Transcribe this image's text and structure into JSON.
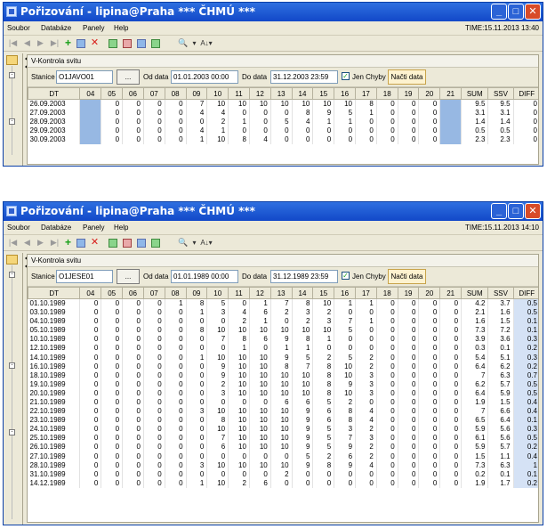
{
  "screens": [
    {
      "title": "Pořizování - lipina@Praha *** ČHMÚ ***",
      "menu": [
        "Soubor",
        "Databáze",
        "Panely",
        "Help"
      ],
      "time": "TIME:15.11.2013 13:40",
      "panel_title": "V-Kontrola svitu",
      "station_label": "Stanice",
      "station_value": "O1JAVO01",
      "browse_label": "...",
      "from_label": "Od data",
      "from_value": "01.01.2003 00:00",
      "to_label": "Do data",
      "to_value": "31.12.2003 23:59",
      "errors_label": "Jen Chyby",
      "load_label": "Načti data",
      "columns": [
        "DT",
        "04",
        "05",
        "06",
        "07",
        "08",
        "09",
        "10",
        "11",
        "12",
        "13",
        "14",
        "15",
        "16",
        "17",
        "18",
        "19",
        "20",
        "21",
        "SUM",
        "SSV",
        "DIFF"
      ],
      "rows": [
        [
          "26.09.2003",
          "",
          "0",
          "0",
          "0",
          "0",
          "7",
          "10",
          "10",
          "10",
          "10",
          "10",
          "10",
          "10",
          "8",
          "0",
          "0",
          "0",
          "",
          "9.5",
          "9.5",
          "0"
        ],
        [
          "27.09.2003",
          "",
          "0",
          "0",
          "0",
          "0",
          "4",
          "4",
          "0",
          "0",
          "0",
          "8",
          "9",
          "5",
          "1",
          "0",
          "0",
          "0",
          "",
          "3.1",
          "3.1",
          "0"
        ],
        [
          "28.09.2003",
          "",
          "0",
          "0",
          "0",
          "0",
          "0",
          "2",
          "1",
          "0",
          "5",
          "4",
          "1",
          "1",
          "0",
          "0",
          "0",
          "0",
          "",
          "1.4",
          "1.4",
          "0"
        ],
        [
          "29.09.2003",
          "",
          "0",
          "0",
          "0",
          "0",
          "4",
          "1",
          "0",
          "0",
          "0",
          "0",
          "0",
          "0",
          "0",
          "0",
          "0",
          "0",
          "",
          "0.5",
          "0.5",
          "0"
        ],
        [
          "30.09.2003",
          "",
          "0",
          "0",
          "0",
          "0",
          "1",
          "10",
          "8",
          "4",
          "0",
          "0",
          "0",
          "0",
          "0",
          "0",
          "0",
          "0",
          "",
          "2.3",
          "2.3",
          "0"
        ]
      ]
    },
    {
      "title": "Pořizování - lipina@Praha *** ČHMÚ ***",
      "menu": [
        "Soubor",
        "Databáze",
        "Panely",
        "Help"
      ],
      "time": "TIME:15.11.2013 14:10",
      "panel_title": "V-Kontrola svitu",
      "station_label": "Stanice",
      "station_value": "O1JESE01",
      "browse_label": "...",
      "from_label": "Od data",
      "from_value": "01.01.1989 00:00",
      "to_label": "Do data",
      "to_value": "31.12.1989 23:59",
      "errors_label": "Jen Chyby",
      "load_label": "Načti data",
      "columns": [
        "DT",
        "04",
        "05",
        "06",
        "07",
        "08",
        "09",
        "10",
        "11",
        "12",
        "13",
        "14",
        "15",
        "16",
        "17",
        "18",
        "19",
        "20",
        "21",
        "SUM",
        "SSV",
        "DIFF"
      ],
      "rows": [
        [
          "01.10.1989",
          "0",
          "0",
          "0",
          "0",
          "1",
          "8",
          "5",
          "0",
          "1",
          "7",
          "8",
          "10",
          "1",
          "1",
          "0",
          "0",
          "0",
          "0",
          "4.2",
          "3.7",
          "0.5"
        ],
        [
          "03.10.1989",
          "0",
          "0",
          "0",
          "0",
          "0",
          "1",
          "3",
          "4",
          "6",
          "2",
          "3",
          "2",
          "0",
          "0",
          "0",
          "0",
          "0",
          "0",
          "2.1",
          "1.6",
          "0.5"
        ],
        [
          "04.10.1989",
          "0",
          "0",
          "0",
          "0",
          "0",
          "0",
          "0",
          "2",
          "1",
          "0",
          "2",
          "3",
          "7",
          "1",
          "0",
          "0",
          "0",
          "0",
          "1.6",
          "1.5",
          "0.1"
        ],
        [
          "05.10.1989",
          "0",
          "0",
          "0",
          "0",
          "0",
          "8",
          "10",
          "10",
          "10",
          "10",
          "10",
          "10",
          "5",
          "0",
          "0",
          "0",
          "0",
          "0",
          "7.3",
          "7.2",
          "0.1"
        ],
        [
          "10.10.1989",
          "0",
          "0",
          "0",
          "0",
          "0",
          "0",
          "7",
          "8",
          "6",
          "9",
          "8",
          "1",
          "0",
          "0",
          "0",
          "0",
          "0",
          "0",
          "3.9",
          "3.6",
          "0.3"
        ],
        [
          "12.10.1989",
          "0",
          "0",
          "0",
          "0",
          "0",
          "0",
          "0",
          "1",
          "0",
          "1",
          "1",
          "0",
          "0",
          "0",
          "0",
          "0",
          "0",
          "0",
          "0.3",
          "0.1",
          "0.2"
        ],
        [
          "14.10.1989",
          "0",
          "0",
          "0",
          "0",
          "0",
          "1",
          "10",
          "10",
          "10",
          "9",
          "5",
          "2",
          "5",
          "2",
          "0",
          "0",
          "0",
          "0",
          "5.4",
          "5.1",
          "0.3"
        ],
        [
          "16.10.1989",
          "0",
          "0",
          "0",
          "0",
          "0",
          "0",
          "9",
          "10",
          "10",
          "8",
          "7",
          "8",
          "10",
          "2",
          "0",
          "0",
          "0",
          "0",
          "6.4",
          "6.2",
          "0.2"
        ],
        [
          "18.10.1989",
          "0",
          "0",
          "0",
          "0",
          "0",
          "0",
          "9",
          "10",
          "10",
          "10",
          "10",
          "8",
          "10",
          "3",
          "0",
          "0",
          "0",
          "0",
          "7",
          "6.3",
          "0.7"
        ],
        [
          "19.10.1989",
          "0",
          "0",
          "0",
          "0",
          "0",
          "0",
          "2",
          "10",
          "10",
          "10",
          "10",
          "8",
          "9",
          "3",
          "0",
          "0",
          "0",
          "0",
          "6.2",
          "5.7",
          "0.5"
        ],
        [
          "20.10.1989",
          "0",
          "0",
          "0",
          "0",
          "0",
          "0",
          "3",
          "10",
          "10",
          "10",
          "10",
          "8",
          "10",
          "3",
          "0",
          "0",
          "0",
          "0",
          "6.4",
          "5.9",
          "0.5"
        ],
        [
          "21.10.1989",
          "0",
          "0",
          "0",
          "0",
          "0",
          "0",
          "0",
          "0",
          "0",
          "6",
          "6",
          "5",
          "2",
          "0",
          "0",
          "0",
          "0",
          "0",
          "1.9",
          "1.5",
          "0.4"
        ],
        [
          "22.10.1989",
          "0",
          "0",
          "0",
          "0",
          "0",
          "3",
          "10",
          "10",
          "10",
          "10",
          "9",
          "6",
          "8",
          "4",
          "0",
          "0",
          "0",
          "0",
          "7",
          "6.6",
          "0.4"
        ],
        [
          "23.10.1989",
          "0",
          "0",
          "0",
          "0",
          "0",
          "0",
          "8",
          "10",
          "10",
          "10",
          "9",
          "6",
          "8",
          "4",
          "0",
          "0",
          "0",
          "0",
          "6.5",
          "6.4",
          "0.1"
        ],
        [
          "24.10.1989",
          "0",
          "0",
          "0",
          "0",
          "0",
          "0",
          "10",
          "10",
          "10",
          "10",
          "9",
          "5",
          "3",
          "2",
          "0",
          "0",
          "0",
          "0",
          "5.9",
          "5.6",
          "0.3"
        ],
        [
          "25.10.1989",
          "0",
          "0",
          "0",
          "0",
          "0",
          "0",
          "7",
          "10",
          "10",
          "10",
          "9",
          "5",
          "7",
          "3",
          "0",
          "0",
          "0",
          "0",
          "6.1",
          "5.6",
          "0.5"
        ],
        [
          "26.10.1989",
          "0",
          "0",
          "0",
          "0",
          "0",
          "0",
          "6",
          "10",
          "10",
          "10",
          "9",
          "5",
          "9",
          "2",
          "0",
          "0",
          "0",
          "0",
          "5.9",
          "5.7",
          "0.2"
        ],
        [
          "27.10.1989",
          "0",
          "0",
          "0",
          "0",
          "0",
          "0",
          "0",
          "0",
          "0",
          "0",
          "5",
          "2",
          "6",
          "2",
          "0",
          "0",
          "0",
          "0",
          "1.5",
          "1.1",
          "0.4"
        ],
        [
          "28.10.1989",
          "0",
          "0",
          "0",
          "0",
          "0",
          "3",
          "10",
          "10",
          "10",
          "10",
          "9",
          "8",
          "9",
          "4",
          "0",
          "0",
          "0",
          "0",
          "7.3",
          "6.3",
          "1"
        ],
        [
          "31.10.1989",
          "0",
          "0",
          "0",
          "0",
          "0",
          "0",
          "0",
          "0",
          "0",
          "2",
          "0",
          "0",
          "0",
          "0",
          "0",
          "0",
          "0",
          "0",
          "0.2",
          "0.1",
          "0.1"
        ],
        [
          "14.12.1989",
          "0",
          "0",
          "0",
          "0",
          "0",
          "1",
          "10",
          "2",
          "6",
          "0",
          "0",
          "0",
          "0",
          "0",
          "0",
          "0",
          "0",
          "0",
          "1.9",
          "1.7",
          "0.2"
        ]
      ]
    }
  ]
}
